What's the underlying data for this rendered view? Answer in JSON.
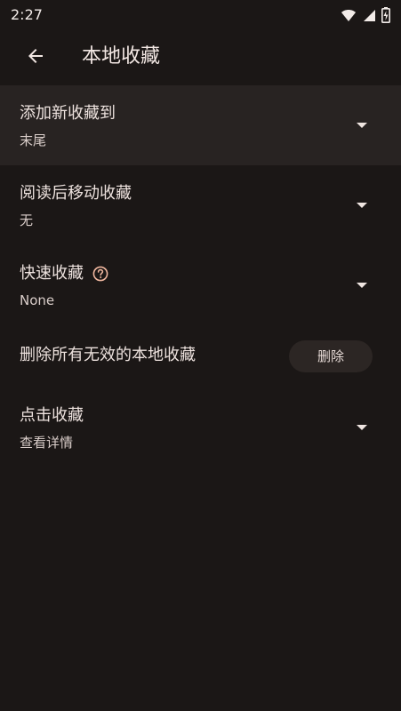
{
  "status_bar": {
    "time": "2:27",
    "icons": [
      "wifi-icon",
      "signal-icon",
      "battery-charging-icon"
    ]
  },
  "app_bar": {
    "title": "本地收藏",
    "back_icon": "arrow-back-icon"
  },
  "settings": [
    {
      "title": "添加新收藏到",
      "value": "末尾"
    },
    {
      "title": "阅读后移动收藏",
      "value": "无"
    },
    {
      "title": "快速收藏",
      "value": "None",
      "help_icon": "help-circle-icon"
    }
  ],
  "delete_invalid": {
    "label": "删除所有无效的本地收藏",
    "button_label": "删除"
  },
  "click_favorite": {
    "title": "点击收藏",
    "value": "查看详情"
  },
  "colors": {
    "background": "#1b1716",
    "highlight": "#282322",
    "help_accent": "#f0b79f",
    "button_bg": "#2c2624"
  }
}
